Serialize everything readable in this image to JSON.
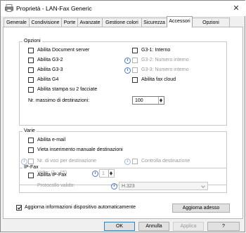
{
  "window": {
    "title": "Proprietà - LAN-Fax Generic",
    "close_glyph": "✕",
    "icon": "fax-printer-icon"
  },
  "tabs": [
    "Generale",
    "Condivisione",
    "Porte",
    "Avanzate",
    "Gestione colori",
    "Sicurezza",
    "Accessori",
    "Opzioni avanzate"
  ],
  "active_tab": "Accessori",
  "opzioni": {
    "title": "Opzioni",
    "left": [
      {
        "label": "Abilita Document server",
        "checked": false
      },
      {
        "label": "Abilita G3-2",
        "checked": false
      },
      {
        "label": "Abilita G3-3",
        "checked": false
      },
      {
        "label": "Abilita G4",
        "checked": false
      },
      {
        "label": "Abilita stampa su 2 facciate",
        "checked": false
      }
    ],
    "right": [
      {
        "label": "G3-1: Interno",
        "checked": false
      },
      {
        "label": "G3-2: Numero interno",
        "checked": false,
        "disabled": true
      },
      {
        "label": "G3-3: Numero interno",
        "checked": false,
        "disabled": true
      },
      {
        "label": "Abilita fax cloud",
        "checked": false
      }
    ],
    "max_dest_label": "Nr. massimo di destinazioni:",
    "max_dest_value": "100"
  },
  "varie": {
    "title": "Varie",
    "items": [
      {
        "label": "Abilita e-mail",
        "checked": false
      },
      {
        "label": "Vieta inserimento manuale destinazioni",
        "checked": false
      }
    ],
    "voice_label": "Nr. di voci per destinazione",
    "voice_range": "Volte: (1 - 15)",
    "voice_value": "1",
    "check_dest_label": "Controlla destinazione"
  },
  "ipfax": {
    "title": "IP-Fax",
    "enable_label": "Abilita IP-Fax",
    "protocol_label": "Protocollo valido:",
    "protocol_value": "H.323"
  },
  "auto_update_label": "Aggiorna informazioni dispositivo automaticamente",
  "auto_update_checked": true,
  "update_now_label": "Aggiorna adesso",
  "footer": {
    "ok": "OK",
    "cancel": "Annulla",
    "apply": "Applica",
    "help": "?"
  }
}
